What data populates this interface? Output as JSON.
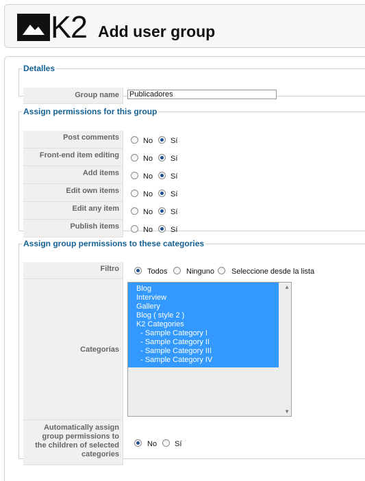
{
  "header": {
    "logo_text": "K2",
    "title": "Add user group"
  },
  "details": {
    "legend": "Detalles",
    "group_name_label": "Group name",
    "group_name_value": "Publicadores"
  },
  "permissions": {
    "legend": "Assign permissions for this group",
    "no_label": "No",
    "yes_label": "Sí",
    "rows": [
      {
        "label": "Post comments",
        "selected": "Sí"
      },
      {
        "label": "Front-end item editing",
        "selected": "Sí"
      },
      {
        "label": "Add items",
        "selected": "Sí"
      },
      {
        "label": "Edit own items",
        "selected": "Sí"
      },
      {
        "label": "Edit any item",
        "selected": "Sí"
      },
      {
        "label": "Publish items",
        "selected": "Sí"
      }
    ]
  },
  "categories": {
    "legend": "Assign group permissions to these categories",
    "filter_label": "Filtro",
    "filter_options": [
      "Todos",
      "Ninguno",
      "Seleccione desde la lista"
    ],
    "filter_selected": "Todos",
    "categories_label": "Categorías",
    "items": [
      "Blog",
      "Interview",
      "Gallery",
      "Blog ( style 2 )",
      "K2 Categories",
      "  - Sample Category I",
      "  - Sample Category II",
      "  - Sample Category III",
      "  - Sample Category IV"
    ],
    "auto_label_lines": [
      "Automatically assign",
      "group permissions to",
      "the children of selected",
      "categories"
    ],
    "auto_no": "No",
    "auto_yes": "Sí",
    "auto_selected": "No"
  }
}
